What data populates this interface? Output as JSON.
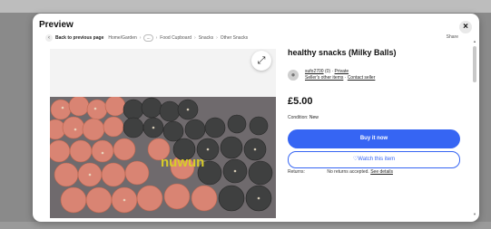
{
  "modal": {
    "title": "Preview",
    "close": "×"
  },
  "breadcrumb": {
    "back_label": "Back to previous page",
    "items": [
      "Home/Garden",
      "...",
      "Food Cupboard",
      "Snacks",
      "Other Snacks"
    ],
    "share_label": "Share"
  },
  "gallery": {
    "expand_icon": "expand-icon",
    "watermark": "nuwun"
  },
  "listing": {
    "title": "healthy snacks (Milky Balls)",
    "seller_name": "sufo2700",
    "seller_rating": "(0)",
    "private_label": "Private",
    "other_items": "Seller's other items",
    "contact": "Contact seller",
    "price": "£5.00",
    "condition_label": "Condition:",
    "condition_value": "New",
    "buy_label": "Buy it now",
    "watch_label": "♡Watch this item",
    "returns_label": "Returns:",
    "returns_text": "No returns accepted.",
    "returns_link": "See details"
  },
  "colors": {
    "accent": "#3665f3",
    "overlay": "#8a8a8a"
  }
}
